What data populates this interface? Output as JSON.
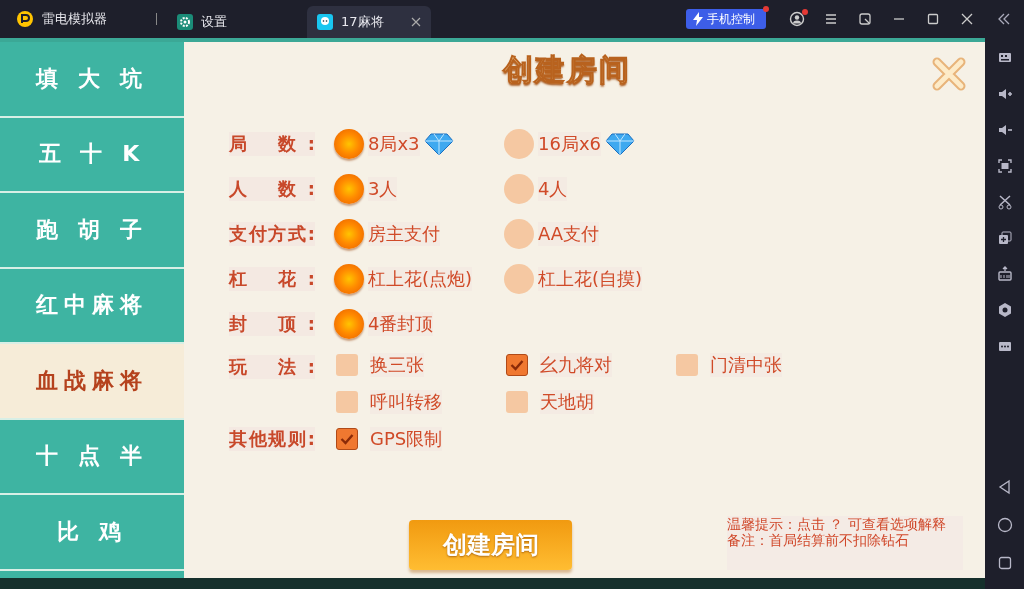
{
  "titlebar": {
    "app_name": "雷电模拟器",
    "tabs": [
      {
        "label": "设置",
        "selected": false,
        "closable": false
      },
      {
        "label": "17麻将",
        "selected": true,
        "closable": true
      }
    ],
    "phone_control": "手机控制"
  },
  "game_menu": [
    {
      "label": "填 大 坑",
      "selected": false
    },
    {
      "label": "五 十 K",
      "selected": false
    },
    {
      "label": "跑 胡 子",
      "selected": false
    },
    {
      "label": "红中麻将",
      "selected": false
    },
    {
      "label": "血战麻将",
      "selected": true
    },
    {
      "label": "十 点 半",
      "selected": false
    },
    {
      "label": "比 鸡",
      "selected": false
    }
  ],
  "dialog": {
    "title": "创建房间",
    "rules": [
      {
        "label": "局 数:",
        "kind": "radio",
        "options": [
          {
            "label": "8局x3",
            "selected": true,
            "diamond": true
          },
          {
            "label": "16局x6",
            "selected": false,
            "diamond": true
          }
        ]
      },
      {
        "label": "人 数:",
        "kind": "radio",
        "options": [
          {
            "label": "3人",
            "selected": true
          },
          {
            "label": "4人",
            "selected": false
          }
        ]
      },
      {
        "label": "支付方式:",
        "kind": "radio",
        "options": [
          {
            "label": "房主支付",
            "selected": true
          },
          {
            "label": "AA支付",
            "selected": false
          }
        ]
      },
      {
        "label": "杠 花:",
        "kind": "radio",
        "options": [
          {
            "label": "杠上花(点炮)",
            "selected": true
          },
          {
            "label": "杠上花(自摸)",
            "selected": false
          }
        ]
      },
      {
        "label": "封 顶:",
        "kind": "radio",
        "options": [
          {
            "label": "4番封顶",
            "selected": true
          }
        ]
      },
      {
        "label": "玩 法:",
        "kind": "checkbox",
        "options": [
          {
            "label": "换三张",
            "checked": false
          },
          {
            "label": "幺九将对",
            "checked": true
          },
          {
            "label": "门清中张",
            "checked": false
          },
          {
            "label": "呼叫转移",
            "checked": false
          },
          {
            "label": "天地胡",
            "checked": false
          }
        ]
      },
      {
        "label": "其他规则:",
        "kind": "checkbox",
        "options": [
          {
            "label": "GPS限制",
            "checked": true
          }
        ]
      }
    ],
    "create_button": "创建房间",
    "hints": [
      "温馨提示：点击 ？ 可查看选项解释",
      "备注：首局结算前不扣除钻石"
    ]
  }
}
